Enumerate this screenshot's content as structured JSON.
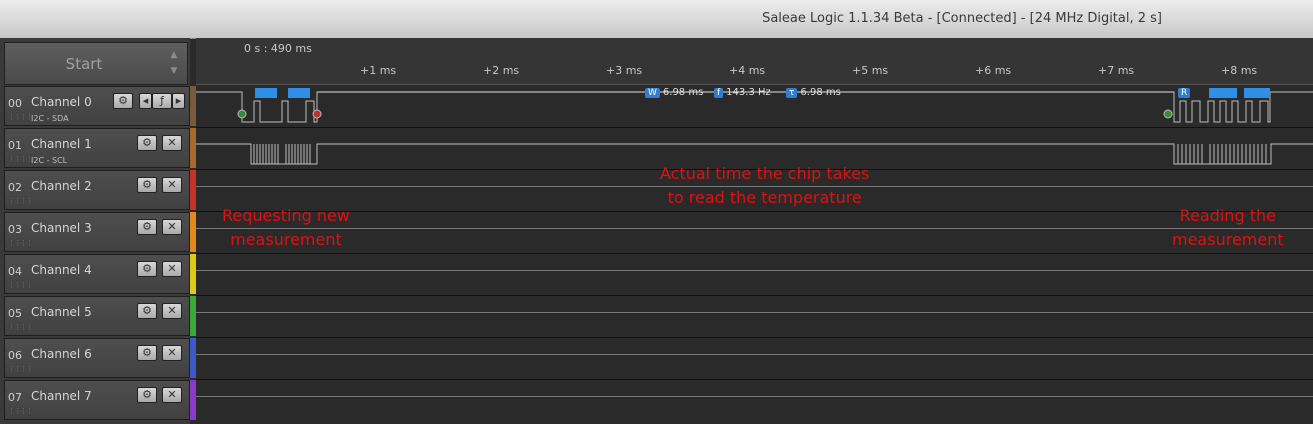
{
  "window": {
    "title": "Saleae Logic 1.1.34 Beta - [Connected] - [24 MHz Digital, 2 s]"
  },
  "left": {
    "start_label": "Start"
  },
  "ruler": {
    "start_time": "0 s : 490 ms",
    "ticks": [
      "+1 ms",
      "+2 ms",
      "+3 ms",
      "+4 ms",
      "+5 ms",
      "+6 ms",
      "+7 ms",
      "+8 ms"
    ]
  },
  "channels": [
    {
      "num": "00",
      "name": "Channel 0",
      "sub": "I2C - SDA",
      "color": "#7a5a3a"
    },
    {
      "num": "01",
      "name": "Channel 1",
      "sub": "I2C - SCL",
      "color": "#a86a2a"
    },
    {
      "num": "02",
      "name": "Channel 2",
      "sub": "",
      "color": "#c8302a"
    },
    {
      "num": "03",
      "name": "Channel 3",
      "sub": "",
      "color": "#e08a1a"
    },
    {
      "num": "04",
      "name": "Channel 4",
      "sub": "",
      "color": "#e0c81a"
    },
    {
      "num": "05",
      "name": "Channel 5",
      "sub": "",
      "color": "#3aa83a"
    },
    {
      "num": "06",
      "name": "Channel 6",
      "sub": "",
      "color": "#3a5ac8"
    },
    {
      "num": "07",
      "name": "Channel 7",
      "sub": "",
      "color": "#8a3ac8"
    }
  ],
  "measurement": {
    "w_label": "W",
    "w_value": "6.98 ms",
    "f_label": "f",
    "f_value": "143.3 Hz",
    "t_label": "τ",
    "t_value": "6.98 ms",
    "r_label": "R"
  },
  "annotations": {
    "request": [
      "Requesting new",
      "measurement"
    ],
    "actual": [
      "Actual time the chip takes",
      "to read the temperature"
    ],
    "reading": [
      "Reading the",
      "measurement"
    ]
  }
}
